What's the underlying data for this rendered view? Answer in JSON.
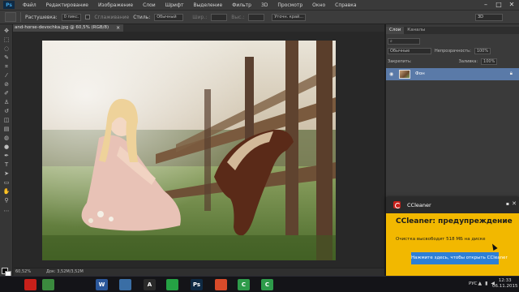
{
  "app": {
    "logo": "Ps"
  },
  "menu": [
    "Файл",
    "Редактирование",
    "Изображение",
    "Слои",
    "Шрифт",
    "Выделение",
    "Фильтр",
    "3D",
    "Просмотр",
    "Окно",
    "Справка"
  ],
  "options": {
    "feather_label": "Растушевка:",
    "feather_value": "0 пикс.",
    "antialias_label": "Сглаживание",
    "style_label": "Стиль:",
    "style_value": "Обычный",
    "width_label": "Шир.:",
    "height_label": "Выс.:",
    "refine_button": "Уточн. край...",
    "workspace_value": "3D"
  },
  "document": {
    "tab_title": "and-horse-devochka.jpg @ 60,5% (RGB/8)",
    "zoom": "60,52%",
    "doc_size": "Док: 3,52М/3,52М"
  },
  "panel": {
    "tabs": [
      "Слои",
      "Каналы"
    ],
    "blend_mode": "Обычные",
    "opacity_label": "Непрозрачность:",
    "opacity_value": "100%",
    "lock_label": "Закрепить:",
    "fill_label": "Заливка:",
    "fill_value": "100%",
    "layer_name": "Фон"
  },
  "toast": {
    "app_name": "CCleaner",
    "title": "CCleaner: предупреждение",
    "message": "Очистка высвободит 518 МБ на диске",
    "button": "Нажмите здесь, чтобы открыть CCleaner",
    "accent": "#f2b800"
  },
  "taskbar": {
    "icons": [
      {
        "name": "ccleaner-icon",
        "glyph": "",
        "color": "#c8201a"
      },
      {
        "name": "chrome-icon",
        "glyph": "",
        "color": "#3b8a3e"
      },
      {
        "name": "word-icon",
        "glyph": "W",
        "color": "#2b579a"
      },
      {
        "name": "maps-icon",
        "glyph": "",
        "color": "#3a6ea5"
      },
      {
        "name": "text-editor-icon",
        "glyph": "A",
        "color": "#2a2a2a"
      },
      {
        "name": "whatsapp-icon",
        "glyph": "",
        "color": "#25a244"
      },
      {
        "name": "photoshop-icon",
        "glyph": "Ps",
        "color": "#0f2a44"
      },
      {
        "name": "chrome-alt-icon",
        "glyph": "",
        "color": "#d84b2a"
      },
      {
        "name": "camtasia-icon",
        "glyph": "C",
        "color": "#2e9b4a"
      },
      {
        "name": "camtasia-recorder-icon",
        "glyph": "C",
        "color": "#2e9b4a"
      }
    ],
    "lang": "РУС",
    "time": "12:33",
    "date": "06.11.2015"
  }
}
